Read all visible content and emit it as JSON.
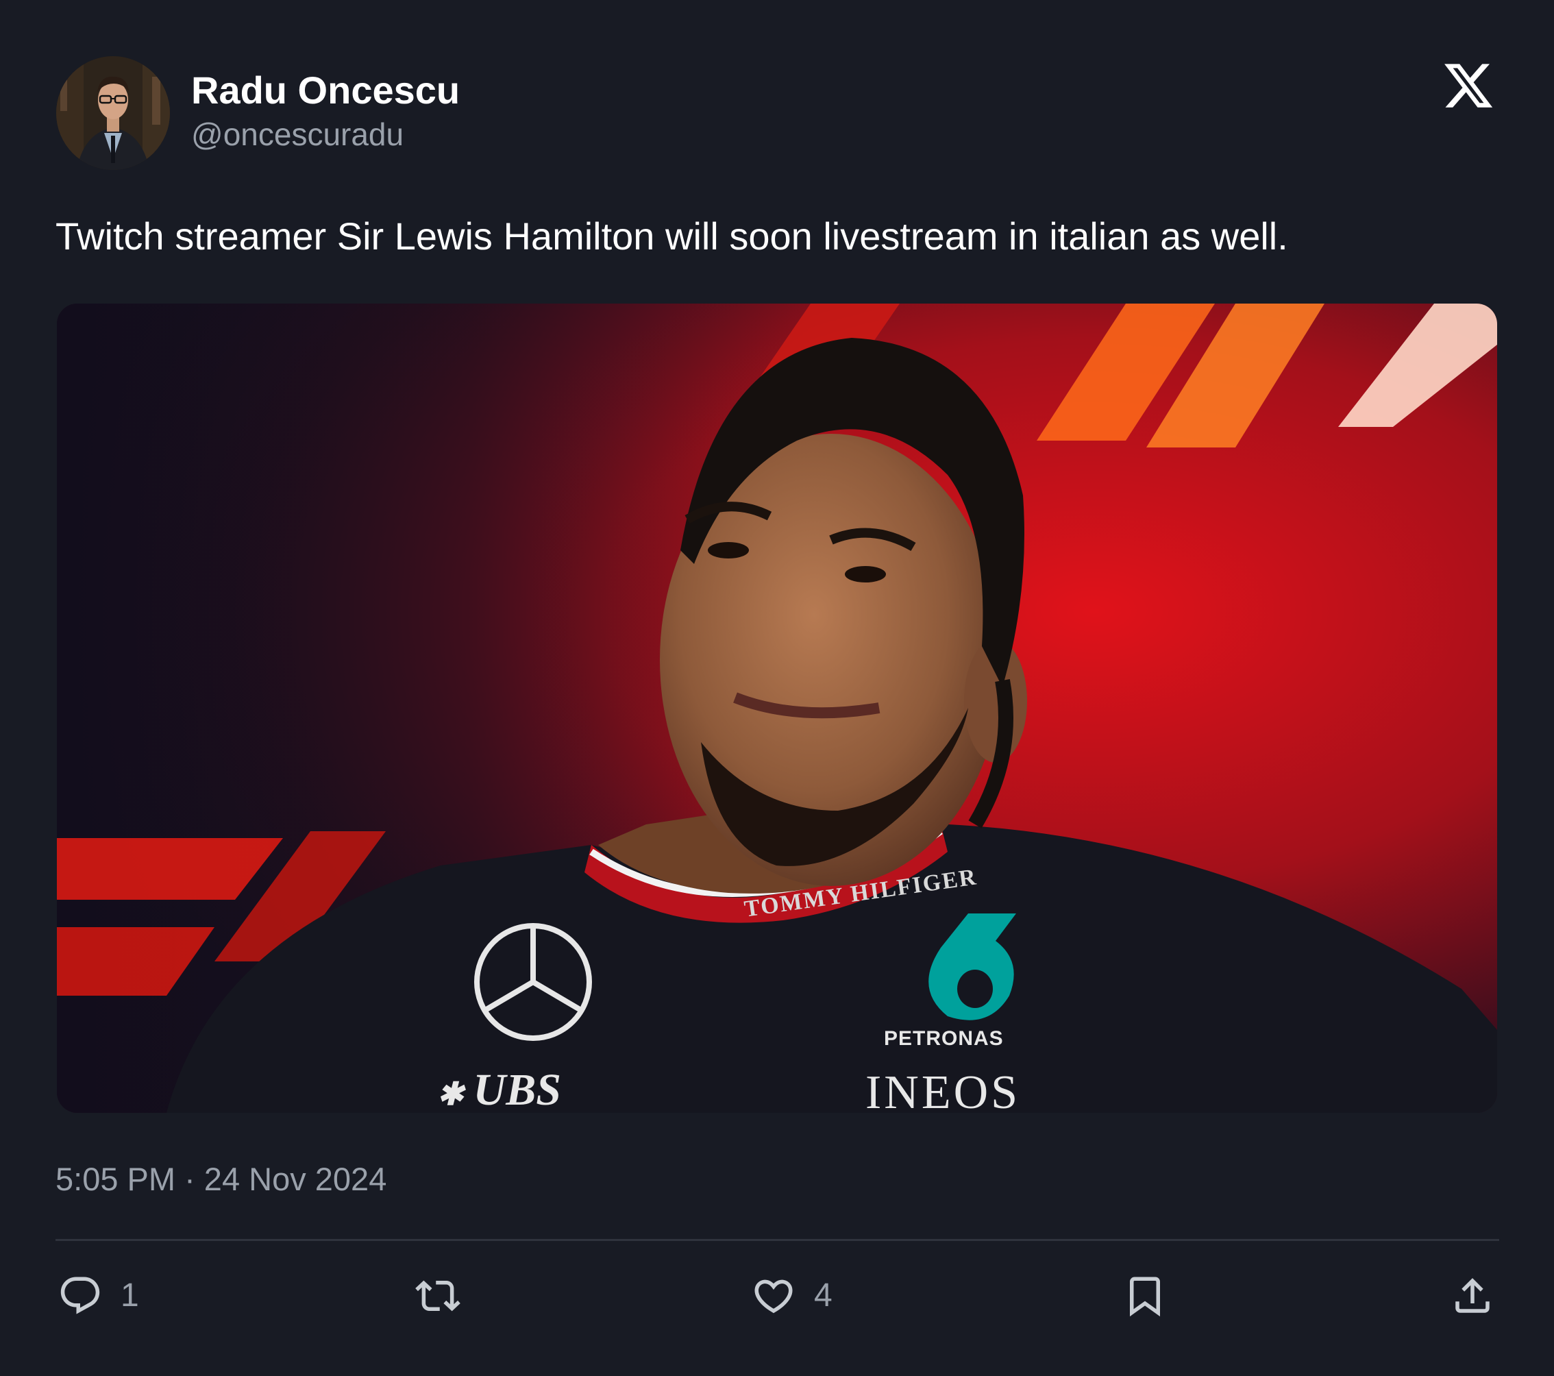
{
  "author": {
    "name": "Radu Oncescu",
    "handle": "@oncescuradu"
  },
  "tweet": {
    "text": "Twitch streamer Sir Lewis Hamilton will soon livestream in italian as well.",
    "timestamp": "5:05 PM · 24 Nov 2024"
  },
  "media": {
    "kind": "photo",
    "shirt_text": {
      "collar": "TOMMY HILFIGER",
      "sponsor_left": "UBS",
      "sponsor_right_top": "PETRONAS",
      "sponsor_right_bottom": "INEOS"
    }
  },
  "actions": {
    "replies": "1",
    "likes": "4"
  },
  "icons": {
    "platform": "x-logo-icon",
    "reply": "reply-icon",
    "retweet": "retweet-icon",
    "like": "heart-icon",
    "bookmark": "bookmark-icon",
    "share": "share-icon"
  },
  "colors": {
    "background": "#181b24",
    "text_primary": "#ffffff",
    "text_secondary": "#9aa1ab",
    "divider": "#2f333d"
  }
}
